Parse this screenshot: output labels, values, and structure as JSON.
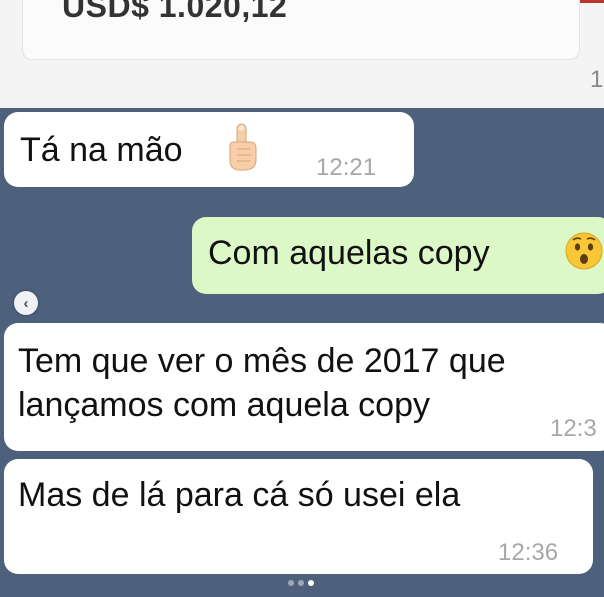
{
  "top_card": {
    "amount": "USD$ 1.020,12",
    "cut_digit": "1"
  },
  "messages": [
    {
      "direction": "incoming",
      "text": "Tá na mão",
      "emoji": "pointing-up-hand-icon",
      "time": "12:21"
    },
    {
      "direction": "outgoing",
      "text": "Com aquelas copy",
      "emoji": "surprised-face-icon",
      "time": ""
    },
    {
      "direction": "incoming",
      "lines": [
        "Tem que ver o mês de 2017 que",
        "lançamos com aquela copy"
      ],
      "time": "12:3"
    },
    {
      "direction": "incoming",
      "text": "Mas de lá para cá só usei ela",
      "time": "12:36"
    }
  ],
  "carousel": {
    "prev_icon": "chevron-left-icon",
    "dots": 3,
    "active_dot": 3
  },
  "colors": {
    "chat_background": "#4d617d",
    "incoming_bubble": "#ffffff",
    "outgoing_bubble": "#dcf8c6",
    "timestamp": "#a7a7a7"
  }
}
